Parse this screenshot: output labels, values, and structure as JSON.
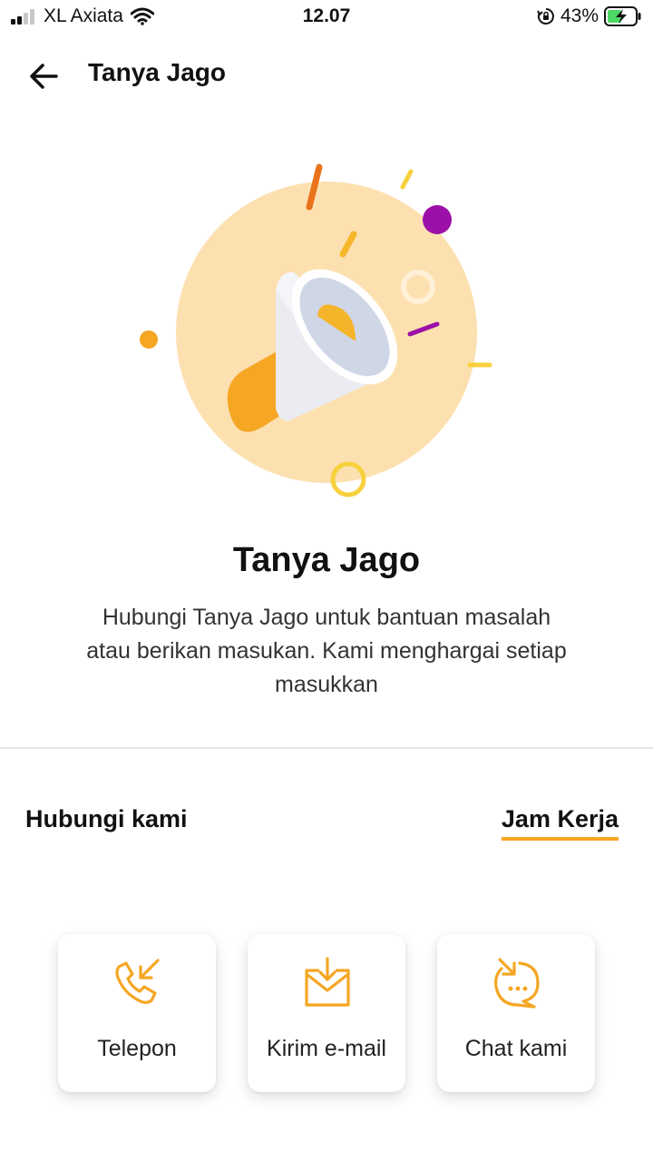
{
  "status_bar": {
    "carrier": "XL Axiata",
    "time": "12.07",
    "battery_percent": "43%"
  },
  "header": {
    "title": "Tanya Jago"
  },
  "hero": {
    "title": "Tanya Jago",
    "description_lines": [
      "Hubungi Tanya Jago untuk bantuan masalah",
      "atau berikan masukan. Kami menghargai setiap",
      "masukkan"
    ]
  },
  "contact": {
    "section_title": "Hubungi kami",
    "hours_link": "Jam Kerja",
    "options": [
      {
        "label": "Telepon",
        "icon": "phone-incoming-icon"
      },
      {
        "label": "Kirim e-mail",
        "icon": "mail-download-icon"
      },
      {
        "label": "Chat kami",
        "icon": "chat-bubble-icon"
      }
    ]
  },
  "colors": {
    "accent": "#F5A623",
    "illustration_circle": "#FDE0B0",
    "purple": "#9C0FA8",
    "orange": "#E8731A"
  }
}
